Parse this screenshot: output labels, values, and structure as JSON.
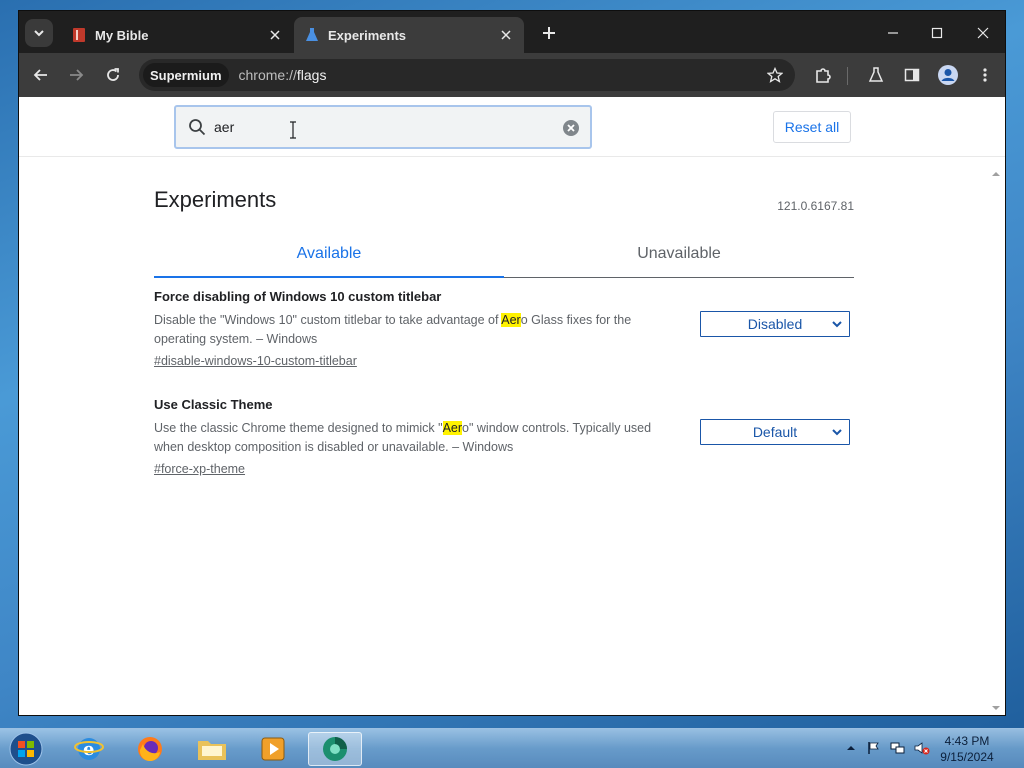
{
  "browser": {
    "tabs": [
      {
        "title": "My Bible",
        "active": false
      },
      {
        "title": "Experiments",
        "active": true
      }
    ],
    "omnibox": {
      "chip": "Supermium",
      "url_scheme": "chrome://",
      "url_host": "flags"
    }
  },
  "page": {
    "search": {
      "value": "aer"
    },
    "reset_label": "Reset all",
    "title": "Experiments",
    "version": "121.0.6167.81",
    "tabs": [
      {
        "label": "Available",
        "selected": true
      },
      {
        "label": "Unavailable",
        "selected": false
      }
    ],
    "flags": [
      {
        "name": "Force disabling of Windows 10 custom titlebar",
        "desc_before": "Disable the \"Windows 10\" custom titlebar to take advantage of ",
        "desc_match": "Aer",
        "desc_after": "o Glass fixes for the operating system. – Windows",
        "link": "#disable-windows-10-custom-titlebar",
        "select_value": "Disabled"
      },
      {
        "name": "Use Classic Theme",
        "desc_before": "Use the classic Chrome theme designed to mimick \"",
        "desc_match": "Aer",
        "desc_after": "o\" window controls. Typically used when desktop composition is disabled or unavailable. – Windows",
        "link": "#force-xp-theme",
        "select_value": "Default"
      }
    ]
  },
  "taskbar": {
    "time": "4:43 PM",
    "date": "9/15/2024"
  },
  "colors": {
    "accent": "#1a73e8",
    "highlight": "#fff200",
    "titlebar": "#1f1f1f",
    "toolbar": "#3c3c3c"
  }
}
